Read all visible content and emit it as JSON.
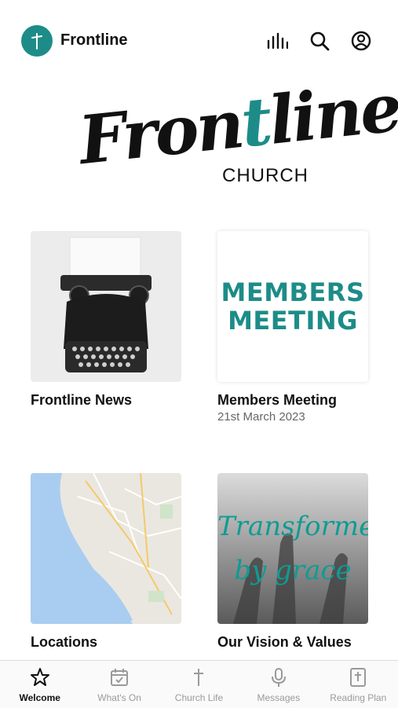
{
  "header": {
    "title": "Frontline",
    "icons": [
      "cross-icon",
      "bar-chart-icon",
      "search-icon",
      "profile-icon"
    ]
  },
  "brand": {
    "script_part1": "Fron",
    "script_accent": "t",
    "script_part2": "line",
    "sub": "CHURCH"
  },
  "cards": [
    {
      "title": "Frontline News",
      "subtitle": ""
    },
    {
      "title": "Members Meeting",
      "subtitle": "21st March 2023",
      "image_text_line1": "MEMBERS",
      "image_text_line2": "MEETING"
    },
    {
      "title": "Locations",
      "subtitle": ""
    },
    {
      "title": "Our Vision & Values",
      "subtitle": "",
      "image_text_line1": "Transformed",
      "image_text_line2": "by grace"
    }
  ],
  "tabs": [
    {
      "label": "Welcome",
      "icon": "star-icon",
      "active": true
    },
    {
      "label": "What's On",
      "icon": "calendar-icon",
      "active": false
    },
    {
      "label": "Church Life",
      "icon": "cross-icon",
      "active": false
    },
    {
      "label": "Messages",
      "icon": "microphone-icon",
      "active": false
    },
    {
      "label": "Reading Plan",
      "icon": "bible-icon",
      "active": false
    }
  ],
  "colors": {
    "accent": "#1d8c88",
    "text": "#111111",
    "muted": "#9a9a9a"
  }
}
